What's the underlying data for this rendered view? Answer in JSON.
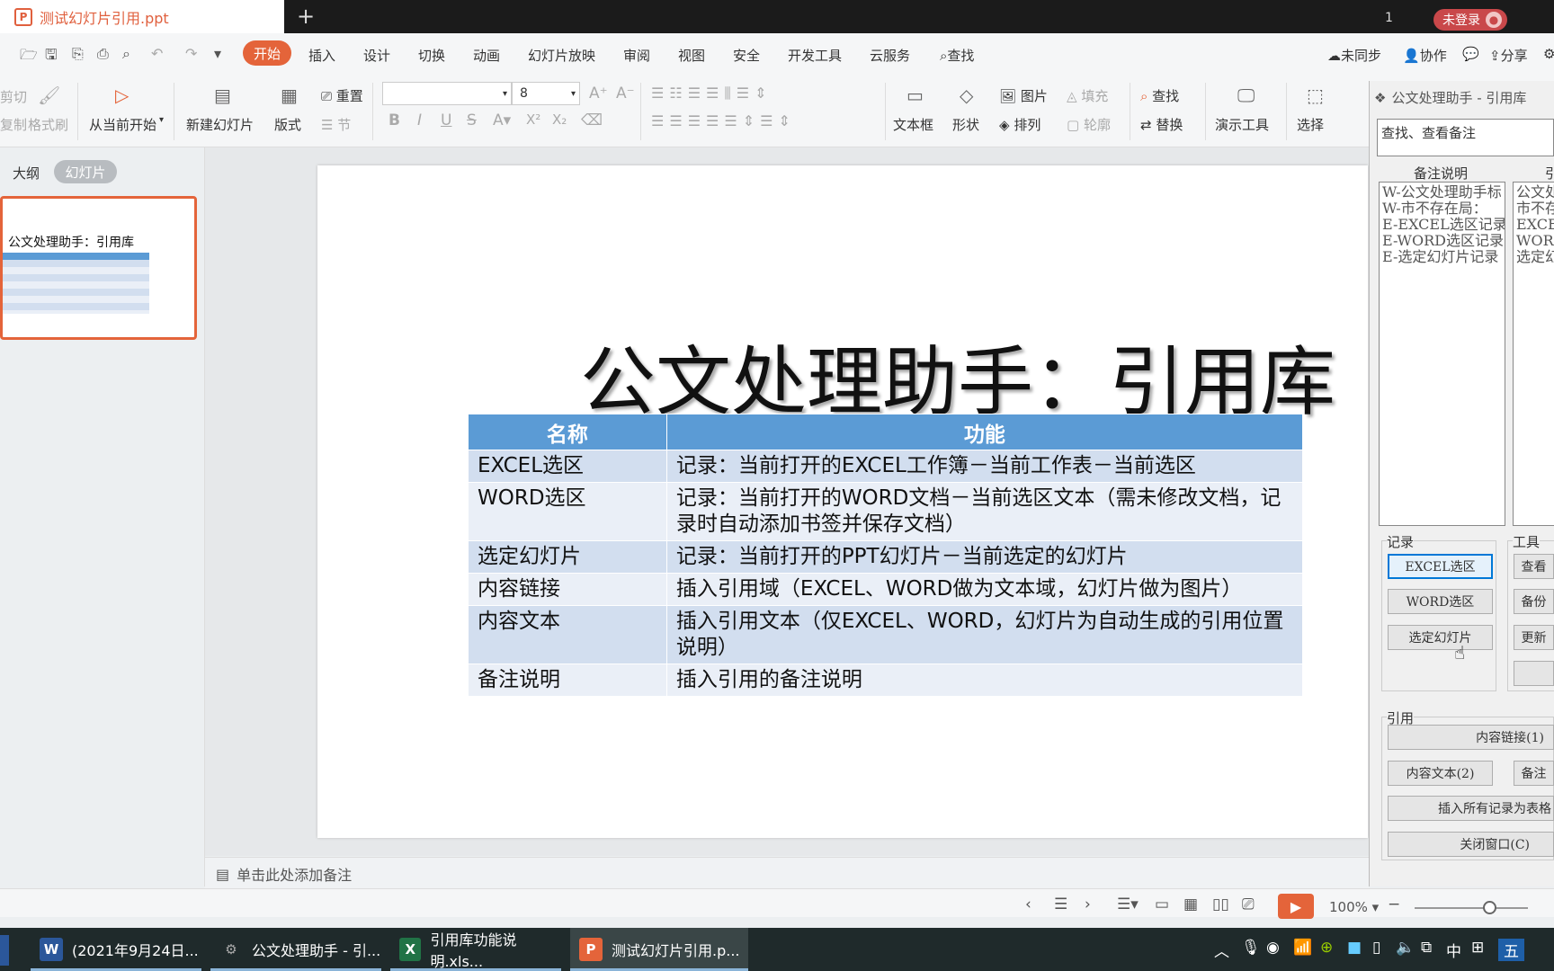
{
  "window": {
    "doc_tab": "测试幻灯片引用.ppt",
    "doc_tab_icon": "P",
    "new_tab": "+",
    "tab_count": "1",
    "login": "未登录"
  },
  "menu": {
    "items": [
      "开始",
      "插入",
      "设计",
      "切换",
      "动画",
      "幻灯片放映",
      "审阅",
      "视图",
      "安全",
      "开发工具",
      "云服务"
    ],
    "search": "查找",
    "sync": "未同步",
    "collab": "协作",
    "share": "分享"
  },
  "ribbon": {
    "cut": "剪切",
    "copy": "复制",
    "format_painter": "格式刷",
    "play_from_current": "从当前开始",
    "new_slide": "新建幻灯片",
    "layout": "版式",
    "reset": "重置",
    "section": "节",
    "font_size": "8",
    "textbox": "文本框",
    "shape": "形状",
    "picture": "图片",
    "arrange": "排列",
    "fill": "填充",
    "outline": "轮廓",
    "find": "查找",
    "replace": "替换",
    "presenter_tools": "演示工具",
    "select": "选择"
  },
  "left_pane": {
    "tab_outline": "大纲",
    "tab_slides": "幻灯片",
    "thumb_title": "公文处理助手：引用库"
  },
  "slide": {
    "title": "公文处理助手：引用库",
    "headers": [
      "名称",
      "功能"
    ],
    "rows": [
      [
        "EXCEL选区",
        "记录：当前打开的EXCEL工作簿－当前工作表－当前选区"
      ],
      [
        "WORD选区",
        "记录：当前打开的WORD文档－当前选区文本（需未修改文档，记录时自动添加书签并保存文档）"
      ],
      [
        "选定幻灯片",
        "记录：当前打开的PPT幻灯片－当前选定的幻灯片"
      ],
      [
        "内容链接",
        "插入引用域（EXCEL、WORD做为文本域，幻灯片做为图片）"
      ],
      [
        "内容文本",
        "插入引用文本（仅EXCEL、WORD，幻灯片为自动生成的引用位置说明）"
      ],
      [
        "备注说明",
        "插入引用的备注说明"
      ]
    ]
  },
  "notes": "单击此处添加备注",
  "status": {
    "zoom": "100%"
  },
  "dialog": {
    "title": "公文处理助手 - 引用库",
    "input_value": "查找、查看备注",
    "col1_header": "备注说明",
    "col2_header": "引",
    "list1": [
      "W-公文处理助手标",
      "W-市不存在局：",
      "E-EXCEL选区记录",
      "E-WORD选区记录：",
      "E-选定幻灯片记录"
    ],
    "list2": [
      "公文处",
      "市不存",
      "EXCEL",
      "WORD选",
      "选定幻"
    ],
    "group_record": "记录",
    "group_tools": "工具",
    "group_reference": "引用",
    "btn_excel": "EXCEL选区",
    "btn_word": "WORD选区",
    "btn_slide": "选定幻灯片",
    "btn_view": "查看",
    "btn_backup": "备份",
    "btn_update": "更新",
    "btn_content_link": "内容链接(1)",
    "btn_content_text": "内容文本(2)",
    "btn_notes": "备注",
    "btn_insert_all": "插入所有记录为表格",
    "btn_close": "关闭窗口(C)"
  },
  "taskbar": {
    "items": [
      "(2021年9月24日...",
      "公文处理助手 - 引...",
      "引用库功能说明.xls...",
      "测试幻灯片引用.p..."
    ],
    "icons": [
      "W",
      "⚙",
      "X",
      "P"
    ],
    "tray_ime": "中",
    "tray_wubi": "五"
  }
}
